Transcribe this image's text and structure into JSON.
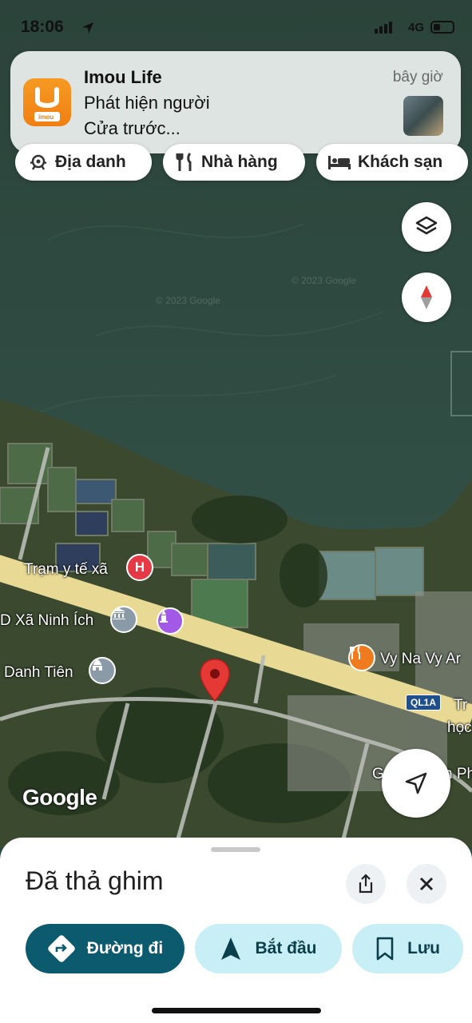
{
  "status_bar": {
    "time": "18:06",
    "network": "4G"
  },
  "notification": {
    "app_name": "Imou Life",
    "app_icon_text": "imou",
    "line1": "Phát hiện người",
    "line2": "Cửa trước...",
    "time": "bây giờ"
  },
  "chips": [
    {
      "label": "Địa danh",
      "icon": "landmark-icon"
    },
    {
      "label": "Nhà hàng",
      "icon": "restaurant-icon"
    },
    {
      "label": "Khách sạn",
      "icon": "hotel-icon"
    }
  ],
  "map": {
    "watermark1": "© 2023 Google",
    "watermark2": "© 2023 Google",
    "pois": [
      {
        "label": "Trạm y tế xã",
        "icon": "hospital-icon",
        "color": "#e53945",
        "glyph": "H"
      },
      {
        "label": "D Xã Ninh Ích",
        "icon": "government-icon",
        "color": "#8a9aa6"
      },
      {
        "label": "Danh Tiên",
        "icon": "temple-icon",
        "color": "#8a9aa6"
      },
      {
        "label": "Vy Na Vy Ar",
        "icon": "restaurant-icon",
        "color": "#f07b1f"
      },
      {
        "label": "Tr",
        "icon": "text"
      },
      {
        "label": "học",
        "icon": "text"
      },
      {
        "label": "G",
        "icon": "text"
      },
      {
        "label": "n Ph",
        "icon": "text"
      }
    ],
    "road_shield": "QL1A",
    "attribution": "Google",
    "colors": {
      "water": "#2f4a40",
      "road": "#e9dc97",
      "pin": "#e53935"
    }
  },
  "sheet": {
    "title": "Đã thả ghim",
    "actions": [
      {
        "label": "Đường đi",
        "icon": "directions-icon",
        "primary": true
      },
      {
        "label": "Bắt đầu",
        "icon": "navigation-arrow-icon",
        "primary": false
      },
      {
        "label": "Lưu",
        "icon": "bookmark-icon",
        "primary": false
      }
    ]
  }
}
